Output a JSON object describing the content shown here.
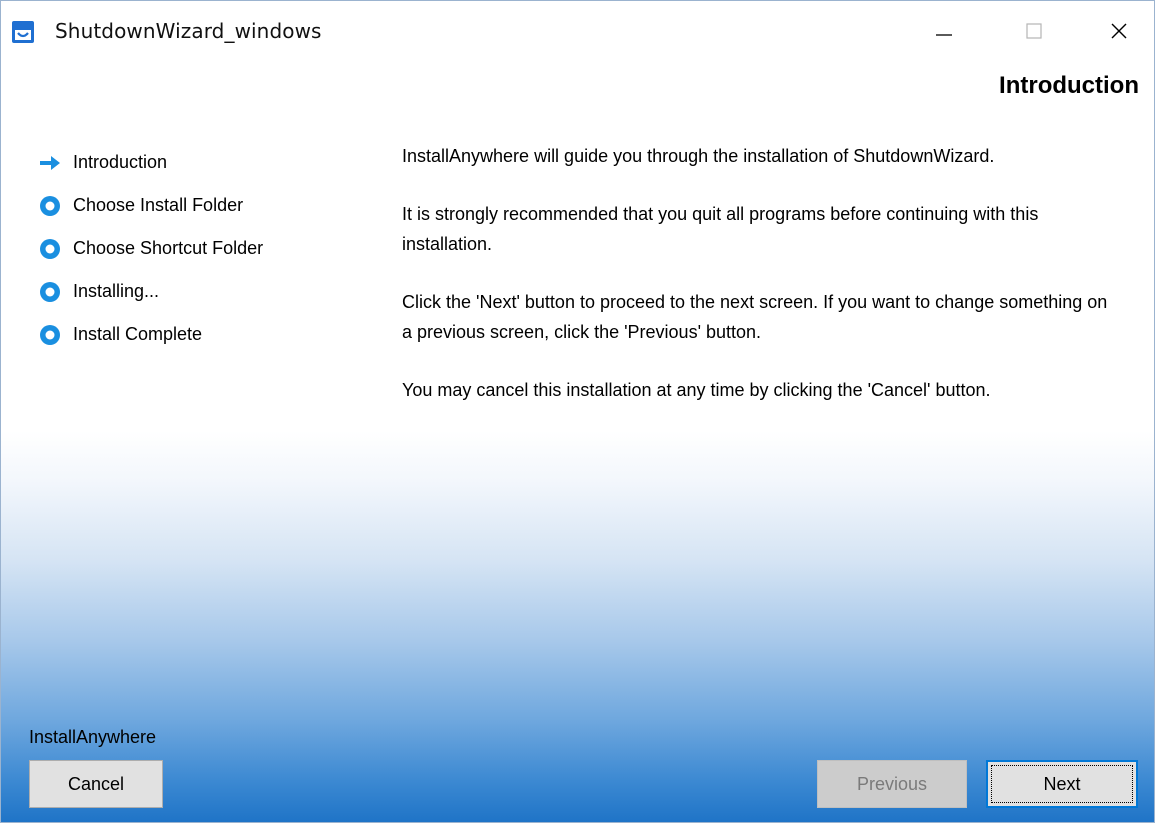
{
  "window": {
    "title": "ShutdownWizard_windows",
    "icon": "installer-app-icon",
    "controls": [
      "minimize-icon",
      "maximize-icon",
      "close-icon"
    ]
  },
  "page": {
    "heading": "Introduction"
  },
  "steps": [
    {
      "label": "Introduction",
      "state": "current",
      "icon": "arrow-right-icon"
    },
    {
      "label": "Choose Install Folder",
      "state": "pending",
      "icon": "circle-icon"
    },
    {
      "label": "Choose Shortcut Folder",
      "state": "pending",
      "icon": "circle-icon"
    },
    {
      "label": "Installing...",
      "state": "pending",
      "icon": "circle-icon"
    },
    {
      "label": "Install Complete",
      "state": "pending",
      "icon": "circle-icon"
    }
  ],
  "content": {
    "paragraphs": [
      "InstallAnywhere will guide you through the installation of ShutdownWizard.",
      "It is strongly recommended that you quit all programs before continuing with this installation.",
      "Click the 'Next' button to proceed to the next screen. If you want to change something on a previous screen, click the 'Previous' button.",
      "You may cancel this installation at any time by clicking the 'Cancel' button."
    ]
  },
  "footer": {
    "brand": "InstallAnywhere",
    "cancel_label": "Cancel",
    "previous_label": "Previous",
    "next_label": "Next",
    "previous_enabled": false
  },
  "colors": {
    "accent": "#1a8fe0",
    "gradient_bottom": "#1f74c7",
    "focus_border": "#0078d7"
  }
}
